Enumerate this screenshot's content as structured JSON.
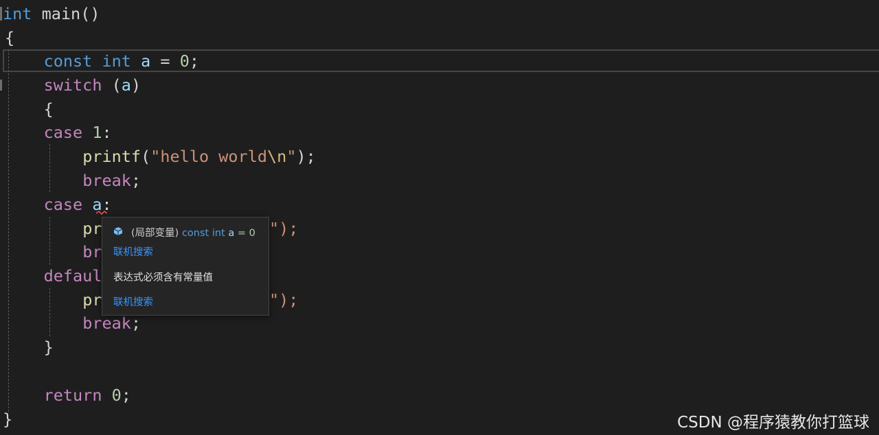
{
  "code": {
    "l1": {
      "kw": "int",
      "rest": " main()"
    },
    "l2": {
      "text": "{"
    },
    "l3": {
      "kw1": "const",
      "kw2": "int",
      "var": "a",
      "op": " = ",
      "num": "0",
      "end": ";"
    },
    "l4": {
      "ctl": "switch",
      "open": " (",
      "var": "a",
      "close": ")"
    },
    "l5": {
      "text": "{"
    },
    "l6": {
      "ctl": "case",
      "num": "1",
      "end": ":"
    },
    "l7": {
      "fn": "printf",
      "open": "(",
      "str1": "\"hello world",
      "esc": "\\n",
      "str2": "\"",
      "end": ");"
    },
    "l8": {
      "ctl": "break",
      "end": ";"
    },
    "l9": {
      "ctl": "case",
      "var": "a",
      "end": ":"
    },
    "l10": {
      "fn": "pr",
      "tail": "\");"
    },
    "l11": {
      "ctl": "br"
    },
    "l12": {
      "ctl": "defaul"
    },
    "l13": {
      "fn": "pr",
      "tail": "\");"
    },
    "l14": {
      "ctl": "break",
      "end": ";"
    },
    "l15": {
      "text": "}"
    },
    "l16": {
      "ctl": "return",
      "num": "0",
      "end": ";"
    },
    "l17": {
      "text": "}"
    }
  },
  "tooltip": {
    "icon": "variable-cube-icon",
    "scope": "(局部变量)",
    "kw1": "const",
    "kw2": "int",
    "var": "a",
    "value_text": "= 0",
    "search_link_1": "联机搜索",
    "error_message": "表达式必须含有常量值",
    "search_link_2": "联机搜索"
  },
  "watermark": "CSDN @程序猿教你打篮球",
  "colors": {
    "background": "#1e1e1e",
    "keyword": "#569cd6",
    "control": "#c586c0",
    "function": "#dcdcaa",
    "number": "#b5cea8",
    "string": "#ce9178",
    "variable": "#9cdcfe",
    "link": "#3794ff",
    "error_squiggle": "#f14c4c"
  }
}
